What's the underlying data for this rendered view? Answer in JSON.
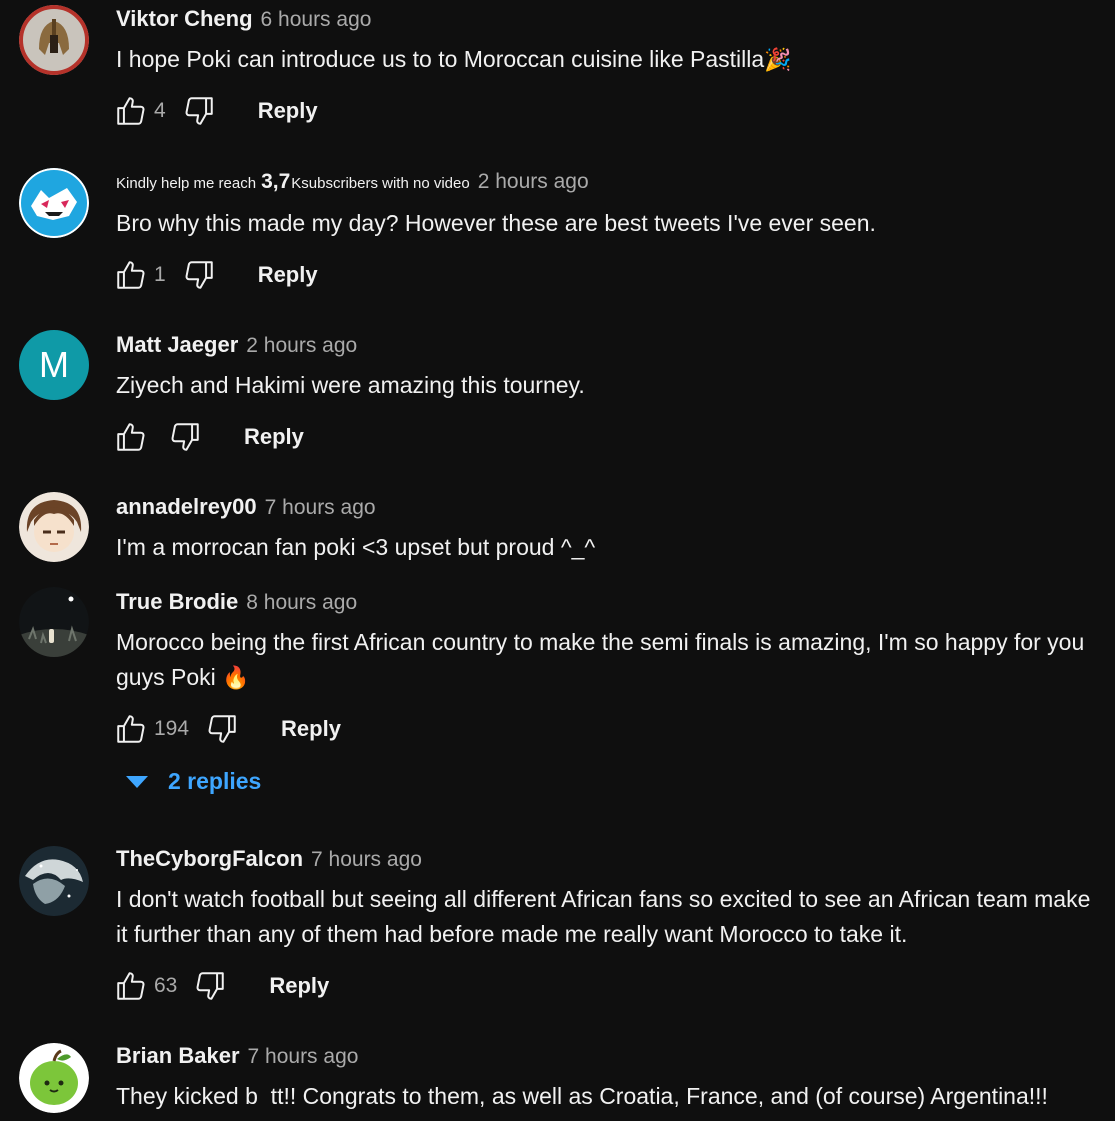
{
  "comments": [
    {
      "author": "Viktor Cheng",
      "time": "6 hours ago",
      "text": "I hope Poki can introduce us to to Moroccan cuisine like Pastilla",
      "emoji": "🎉",
      "likes": "4",
      "reply_label": "Reply",
      "avatar": "spartan-helmet"
    },
    {
      "author_prefix": "Kindly help me reach",
      "author_big": "3,7",
      "author_suffix": "Ksubscribers with no video",
      "time": "2 hours ago",
      "text": "Bro why this made my day? However these are best tweets I've ever seen.",
      "likes": "1",
      "reply_label": "Reply",
      "avatar": "blue-cat-logo"
    },
    {
      "author": "Matt Jaeger",
      "time": "2 hours ago",
      "text": "Ziyech and Hakimi were amazing this tourney.",
      "likes": "",
      "reply_label": "Reply",
      "avatar_letter": "M",
      "avatar_color": "#0f9aa7"
    },
    {
      "author": "annadelrey00",
      "time": "7 hours ago",
      "text": "I'm a morrocan fan poki <3 upset but proud ^_^",
      "avatar": "anime-face"
    },
    {
      "author": "True Brodie",
      "time": "8 hours ago",
      "text": "Morocco being the first African country to make the semi finals is amazing, I'm so happy for you guys Poki",
      "emoji": "🔥",
      "likes": "194",
      "reply_label": "Reply",
      "replies_label": "2 replies",
      "avatar": "night-figure"
    },
    {
      "author": "TheCyborgFalcon",
      "time": "7 hours ago",
      "text": "I don't watch football but seeing all different African fans so excited to see an African team make it further than any of them had before made me really want Morocco to take it.",
      "likes": "63",
      "reply_label": "Reply",
      "avatar": "space-dragon"
    },
    {
      "author": "Brian Baker",
      "time": "7 hours ago",
      "text": "They kicked b  tt!! Congrats to them, as well as Croatia, France, and (of course) Argentina!!!",
      "avatar": "green-apple"
    }
  ],
  "colors": {
    "background": "#0f0f0f",
    "text": "#f1f1f1",
    "secondary": "#aaaaaa",
    "link": "#3ea6ff"
  }
}
